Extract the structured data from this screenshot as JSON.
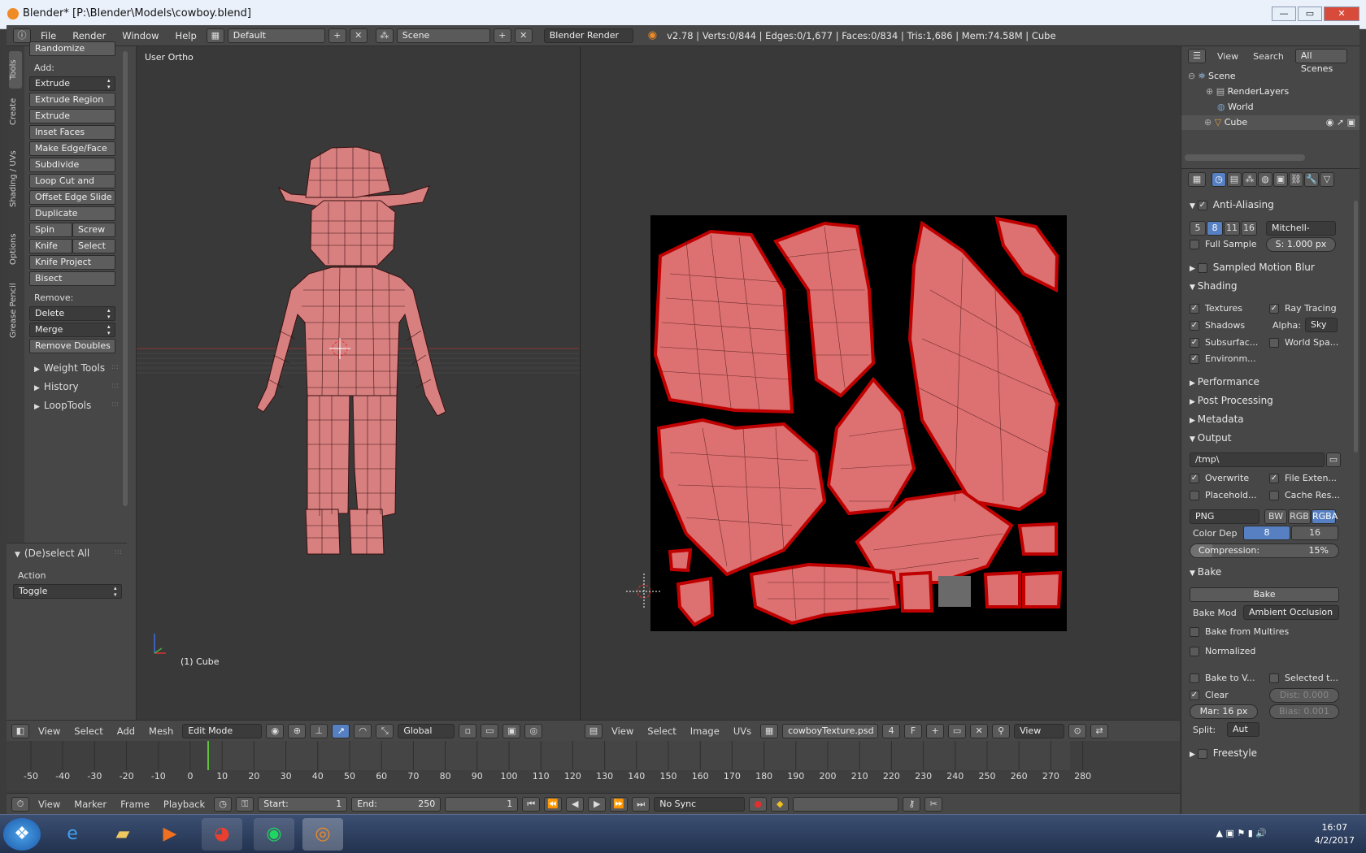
{
  "window": {
    "title": "Blender* [P:\\Blender\\Models\\cowboy.blend]",
    "btn_min": "—",
    "btn_max": "▭",
    "btn_close": "✕"
  },
  "menu": {
    "file": "File",
    "render": "Render",
    "window": "Window",
    "help": "Help",
    "layout": "Default",
    "scene": "Scene",
    "engine": "Blender Render",
    "stats": "v2.78 | Verts:0/844 | Edges:0/1,677 | Faces:0/834 | Tris:1,686 | Mem:74.58M | Cube"
  },
  "tabs": [
    "Tools",
    "Create",
    "Shading / UVs",
    "Options",
    "Grease Pencil"
  ],
  "tools": {
    "randomize": "Randomize",
    "add_label": "Add:",
    "extrude": "Extrude",
    "extrude_region": "Extrude Region",
    "extrude_individual": "Extrude Individual",
    "inset_faces": "Inset Faces",
    "make_edge_face": "Make Edge/Face",
    "subdivide": "Subdivide",
    "loop_cut": "Loop Cut and Slide",
    "offset_edge": "Offset Edge Slide",
    "duplicate": "Duplicate",
    "spin": "Spin",
    "screw": "Screw",
    "knife": "Knife",
    "select": "Select",
    "knife_project": "Knife Project",
    "bisect": "Bisect",
    "remove_label": "Remove:",
    "delete": "Delete",
    "merge": "Merge",
    "remove_doubles": "Remove Doubles",
    "weight_tools": "Weight Tools",
    "history": "History",
    "looptools": "LoopTools"
  },
  "operator": {
    "title": "(De)select All",
    "action_label": "Action",
    "action_value": "Toggle"
  },
  "viewport3d": {
    "view_name": "User Ortho",
    "object_name": "(1) Cube",
    "menus": {
      "view": "View",
      "select": "Select",
      "add": "Add",
      "mesh": "Mesh"
    },
    "mode": "Edit Mode",
    "orientation": "Global"
  },
  "uv_editor": {
    "menus": {
      "view": "View",
      "select": "Select",
      "image": "Image",
      "uvs": "UVs"
    },
    "image_name": "cowboyTexture.psd",
    "users": "4",
    "fake": "F",
    "view_btn": "View"
  },
  "outliner": {
    "view": "View",
    "search": "Search",
    "all_scenes": "All Scenes",
    "items": {
      "scene": "Scene",
      "renderlayers": "RenderLayers",
      "world": "World",
      "cube": "Cube"
    }
  },
  "properties": {
    "aa": {
      "title": "Anti-Aliasing",
      "samples": [
        "5",
        "8",
        "11",
        "16"
      ],
      "filter": "Mitchell-Net...",
      "full_sample": "Full Sample",
      "size": "S: 1.000 px"
    },
    "motion_blur": "Sampled Motion Blur",
    "shading": {
      "title": "Shading",
      "textures": "Textures",
      "ray_tracing": "Ray Tracing",
      "shadows": "Shadows",
      "alpha_label": "Alpha:",
      "alpha_value": "Sky",
      "subsurface": "Subsurfac...",
      "world_space": "World Spa...",
      "environment": "Environm..."
    },
    "performance": "Performance",
    "post_processing": "Post Processing",
    "metadata": "Metadata",
    "output": {
      "title": "Output",
      "path": "/tmp\\",
      "overwrite": "Overwrite",
      "file_ext": "File Exten...",
      "placeholders": "Placehold...",
      "cache": "Cache Res...",
      "format": "PNG",
      "bw": "BW",
      "rgb": "RGB",
      "rgba": "RGBA",
      "color_depth_label": "Color Dep",
      "depth_8": "8",
      "depth_16": "16",
      "compression_label": "Compression:",
      "compression_value": "15%",
      "compression_fraction": 0.15
    },
    "bake": {
      "title": "Bake",
      "bake_btn": "Bake",
      "mode_label": "Bake Mod",
      "mode_value": "Ambient Occlusion",
      "from_multires": "Bake from Multires",
      "normalized": "Normalized",
      "bake_to_vertex": "Bake to V...",
      "selected": "Selected t...",
      "clear": "Clear",
      "dist": "Dist: 0.000",
      "margin": "Mar: 16 px",
      "bias": "Bias: 0.001",
      "split_label": "Split:",
      "split_value": "Aut"
    },
    "freestyle": "Freestyle"
  },
  "timeline": {
    "ticks": [
      "-50",
      "-40",
      "-30",
      "-20",
      "-10",
      "0",
      "10",
      "20",
      "30",
      "40",
      "50",
      "60",
      "70",
      "80",
      "90",
      "100",
      "110",
      "120",
      "130",
      "140",
      "150",
      "160",
      "170",
      "180",
      "190",
      "200",
      "210",
      "220",
      "230",
      "240",
      "250",
      "260",
      "270",
      "280"
    ],
    "menus": {
      "view": "View",
      "marker": "Marker",
      "frame": "Frame",
      "playback": "Playback"
    },
    "start": "Start:",
    "start_val": "1",
    "end": "End:",
    "end_val": "250",
    "current": "1",
    "sync": "No Sync"
  },
  "taskbar": {
    "time": "16:07",
    "date": "4/2/2017"
  }
}
